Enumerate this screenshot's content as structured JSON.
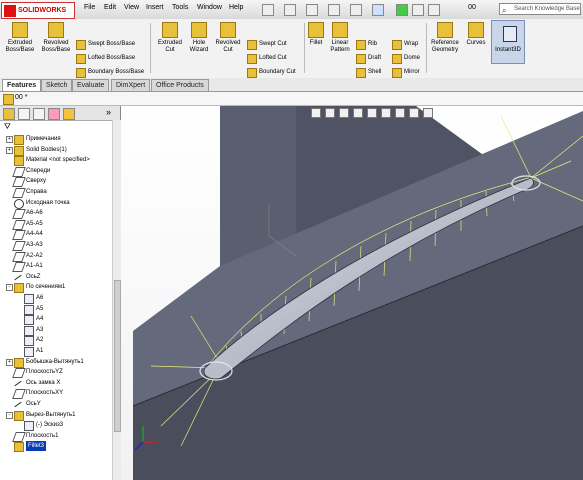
{
  "app": {
    "brand": "SOLIDWORKS",
    "document_title": "00",
    "search_placeholder": "Search Knowledge Base"
  },
  "menu": [
    "File",
    "Edit",
    "View",
    "Insert",
    "Tools",
    "Window",
    "Help"
  ],
  "toolbar": {
    "big": [
      {
        "label": "Extruded\nBoss/Base",
        "icon": "extruded-boss-icon"
      },
      {
        "label": "Revolved\nBoss/Base",
        "icon": "revolved-boss-icon"
      },
      {
        "label": "Extruded\nCut",
        "icon": "extruded-cut-icon"
      },
      {
        "label": "Hole\nWizard",
        "icon": "hole-wizard-icon"
      },
      {
        "label": "Revolved\nCut",
        "icon": "revolved-cut-icon"
      },
      {
        "label": "Fillet",
        "icon": "fillet-icon"
      },
      {
        "label": "Linear\nPattern",
        "icon": "linear-pattern-icon"
      },
      {
        "label": "Reference\nGeometry",
        "icon": "reference-geometry-icon"
      },
      {
        "label": "Curves",
        "icon": "curves-icon"
      }
    ],
    "small": [
      "Swept Boss/Base",
      "Lofted Boss/Base",
      "Boundary Boss/Base",
      "Swept Cut",
      "Lofted Cut",
      "Boundary Cut",
      "Rib",
      "Draft",
      "Shell",
      "Wrap",
      "Dome",
      "Mirror"
    ],
    "instant3d": "Instant3D"
  },
  "tabs": [
    "Features",
    "Sketch",
    "Evaluate",
    "DimXpert",
    "Office Products"
  ],
  "active_tab": "Features",
  "doc_name": "00 *",
  "tree": [
    {
      "label": "Примечания",
      "type": "feat",
      "pm": "+"
    },
    {
      "label": "Solid Bodies(1)",
      "type": "feat",
      "pm": "+"
    },
    {
      "label": "Material <not specified>",
      "type": "feat"
    },
    {
      "label": "Спереди",
      "type": "plane"
    },
    {
      "label": "Сверху",
      "type": "plane"
    },
    {
      "label": "Справа",
      "type": "plane"
    },
    {
      "label": "Исходная точка",
      "type": "origin"
    },
    {
      "label": "A6-A6",
      "type": "plane"
    },
    {
      "label": "A5-A5",
      "type": "plane"
    },
    {
      "label": "A4-A4",
      "type": "plane"
    },
    {
      "label": "A3-A3",
      "type": "plane"
    },
    {
      "label": "A2-A2",
      "type": "plane"
    },
    {
      "label": "A1-A1",
      "type": "plane"
    },
    {
      "label": "ОсьZ",
      "type": "axis"
    },
    {
      "label": "По сечениям1",
      "type": "feat",
      "pm": "-"
    },
    {
      "label": "A6",
      "type": "sketch",
      "indent": 1
    },
    {
      "label": "A5",
      "type": "sketch",
      "indent": 1
    },
    {
      "label": "A4",
      "type": "sketch",
      "indent": 1
    },
    {
      "label": "A3",
      "type": "sketch",
      "indent": 1
    },
    {
      "label": "A2",
      "type": "sketch",
      "indent": 1
    },
    {
      "label": "A1",
      "type": "sketch",
      "indent": 1
    },
    {
      "label": "Бобышка-Вытянуть1",
      "type": "feat",
      "pm": "+"
    },
    {
      "label": "ПлоскостьYZ",
      "type": "plane"
    },
    {
      "label": "Ось замка X",
      "type": "axis"
    },
    {
      "label": "ПлоскостьXY",
      "type": "plane"
    },
    {
      "label": "ОсьY",
      "type": "axis"
    },
    {
      "label": "Вырез-Вытянуть1",
      "type": "feat",
      "pm": "-"
    },
    {
      "label": "(-) Эскиз3",
      "type": "sketch",
      "indent": 1
    },
    {
      "label": "Плоскость1",
      "type": "plane"
    },
    {
      "label": "Fillet3",
      "type": "feat",
      "selected": true
    }
  ],
  "colors": {
    "accent": "#0a3bb4",
    "model_face": "#5c6275",
    "model_dark": "#3b3f4c",
    "comb": "#e8eb7a"
  }
}
